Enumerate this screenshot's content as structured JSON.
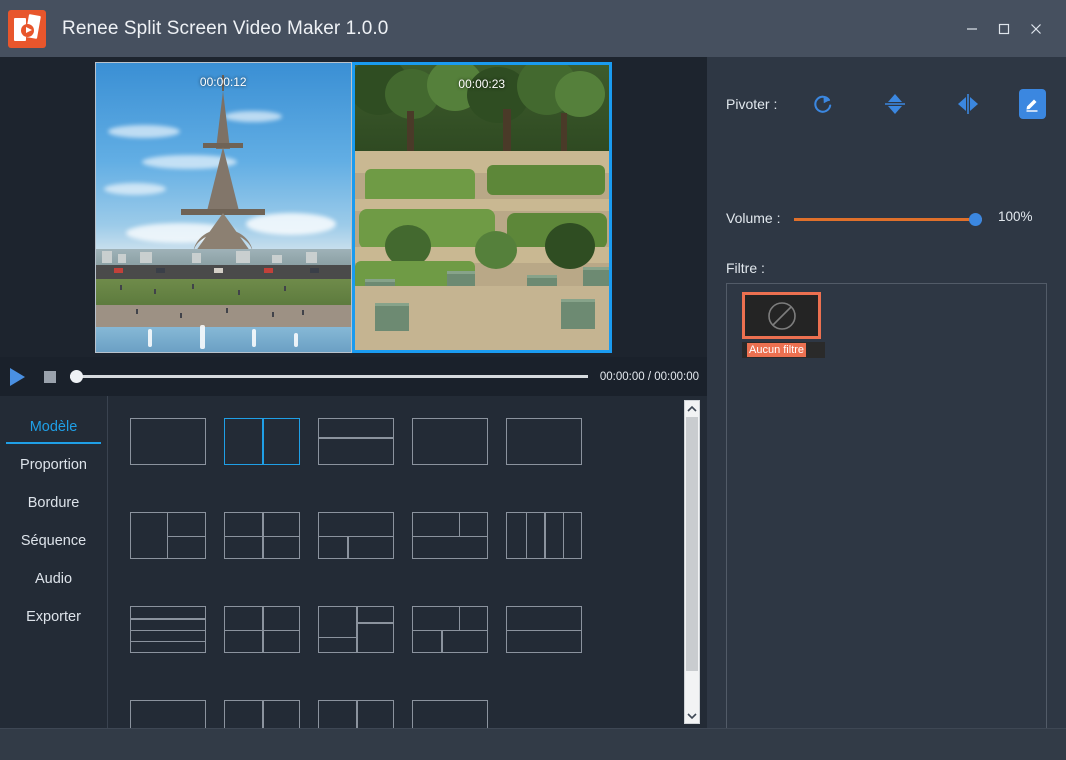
{
  "window": {
    "title": "Renee Split Screen Video Maker 1.0.0",
    "app_icon": "film-play-icon",
    "controls": {
      "minimize": "minimize-icon",
      "maximize": "maximize-icon",
      "close": "close-icon"
    }
  },
  "preview": {
    "panels": [
      {
        "name": "eiffel-tower-clip",
        "duration": "00:00:12",
        "selected": false
      },
      {
        "name": "garden-clip",
        "duration": "00:00:23",
        "selected": true
      }
    ],
    "selection_color": "#1a9bf0"
  },
  "playback": {
    "play_icon": "play-icon",
    "stop_icon": "stop-icon",
    "position_percent": 0,
    "timecode": "00:00:00 / 00:00:00"
  },
  "tabs": [
    {
      "label": "Modèle",
      "active": true
    },
    {
      "label": "Proportion",
      "active": false
    },
    {
      "label": "Bordure",
      "active": false
    },
    {
      "label": "Séquence",
      "active": false
    },
    {
      "label": "Audio",
      "active": false
    },
    {
      "label": "Exporter",
      "active": false
    }
  ],
  "templates": {
    "selected_index": 1,
    "selected_color": "#1f9fe6",
    "items": [
      {
        "id": "single",
        "rows": [],
        "cols": []
      },
      {
        "id": "two-columns",
        "rows": [],
        "cols": [
          50
        ]
      },
      {
        "id": "two-rows",
        "rows": [
          40
        ],
        "cols": []
      },
      {
        "id": "single-b",
        "rows": [],
        "cols": []
      },
      {
        "id": "single-c",
        "rows": [],
        "cols": []
      },
      {
        "id": "left-full-two-right",
        "rows": [],
        "cols": []
      },
      {
        "id": "two-by-two",
        "rows": [
          50
        ],
        "cols": [
          50
        ]
      },
      {
        "id": "top-full-two-bottom",
        "rows": [],
        "cols": []
      },
      {
        "id": "two-top-full-bottom",
        "rows": [],
        "cols": []
      },
      {
        "id": "four-columns",
        "rows": [],
        "cols": [
          25,
          50,
          75
        ]
      },
      {
        "id": "four-rows",
        "rows": [
          25,
          50,
          75
        ],
        "cols": []
      },
      {
        "id": "two-by-two-b",
        "rows": [
          50
        ],
        "cols": [
          50
        ]
      },
      {
        "id": "right-split",
        "rows": [],
        "cols": []
      },
      {
        "id": "mixed-grid",
        "rows": [],
        "cols": []
      },
      {
        "id": "two-rows-b",
        "rows": [
          50
        ],
        "cols": []
      },
      {
        "id": "single-d",
        "rows": [],
        "cols": []
      },
      {
        "id": "two-columns-b",
        "rows": [],
        "cols": [
          50
        ]
      },
      {
        "id": "two-columns-c",
        "rows": [],
        "cols": [
          50
        ]
      },
      {
        "id": "single-e",
        "rows": [],
        "cols": []
      }
    ]
  },
  "scrollbar": {
    "up_icon": "chevron-up-icon",
    "down_icon": "chevron-down-icon"
  },
  "right_panel": {
    "rotate_label": "Pivoter :",
    "rotate_icon": "rotate-clockwise-icon",
    "flip_vertical_icon": "flip-vertical-icon",
    "flip_horizontal_icon": "flip-horizontal-icon",
    "edit_icon": "pencil-edit-icon",
    "volume_label": "Volume :",
    "volume_value": "100%",
    "volume_percent": 100,
    "volume_track_color": "#e0702b",
    "volume_thumb_color": "#3b87e0",
    "filter_label": "Filtre :",
    "filters": [
      {
        "name": "no-filter",
        "label": "Aucun filtre",
        "icon": "no-entry-icon",
        "selected": true
      }
    ],
    "filter_selected_color": "#ec7050"
  }
}
